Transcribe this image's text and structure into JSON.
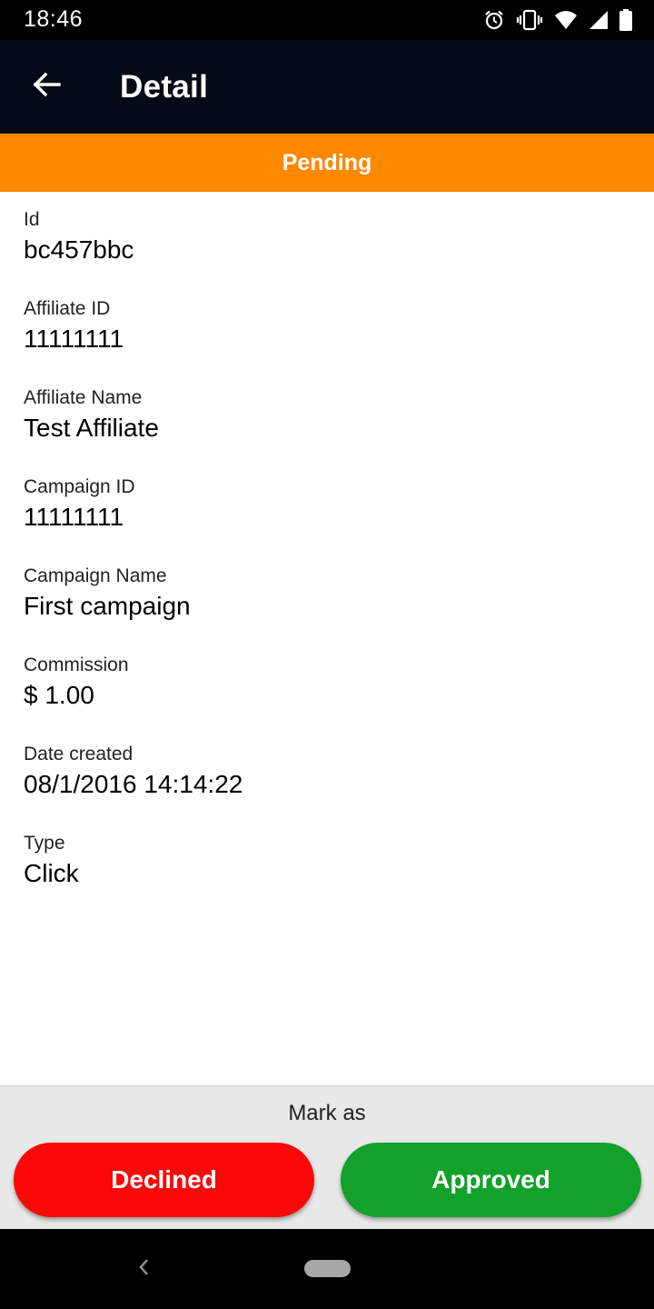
{
  "status_bar": {
    "time": "18:46",
    "icons": [
      "alarm-icon",
      "vibrate-icon",
      "wifi-icon",
      "cell-signal-icon",
      "battery-icon"
    ]
  },
  "app_bar": {
    "title": "Detail",
    "back_icon": "arrow-left-icon"
  },
  "banner": {
    "status": "Pending",
    "color": "#fe8800"
  },
  "details": [
    {
      "label": "Id",
      "value": "bc457bbc"
    },
    {
      "label": "Affiliate ID",
      "value": "11111111"
    },
    {
      "label": "Affiliate Name",
      "value": "Test Affiliate"
    },
    {
      "label": "Campaign ID",
      "value": "11111111"
    },
    {
      "label": "Campaign Name",
      "value": "First campaign"
    },
    {
      "label": "Commission",
      "value": "$ 1.00"
    },
    {
      "label": "Date created",
      "value": "08/1/2016 14:14:22"
    },
    {
      "label": "Type",
      "value": "Click"
    }
  ],
  "actions": {
    "heading": "Mark as",
    "declined_label": "Declined",
    "approved_label": "Approved",
    "declined_color": "#fb0808",
    "approved_color": "#12a12a"
  },
  "nav_bar": {
    "back_icon": "nav-back-icon",
    "home_icon": "home-pill-icon"
  }
}
